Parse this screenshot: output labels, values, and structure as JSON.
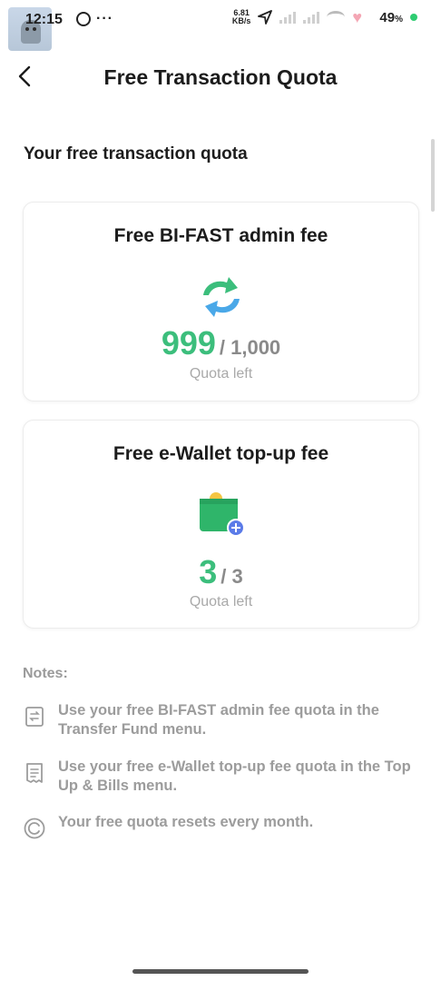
{
  "status_bar": {
    "time": "12:15",
    "net_speed_value": "6.81",
    "net_speed_unit": "KB/s",
    "battery": "49",
    "battery_unit": "%"
  },
  "header": {
    "title": "Free Transaction Quota"
  },
  "section": {
    "title": "Your free transaction quota"
  },
  "cards": [
    {
      "title": "Free BI-FAST admin fee",
      "icon": "transfer-arrows-icon",
      "used": "999",
      "total": "/ 1,000",
      "label": "Quota left"
    },
    {
      "title": "Free e-Wallet top-up fee",
      "icon": "wallet-icon",
      "used": "3",
      "total": "/ 3",
      "label": "Quota left"
    }
  ],
  "notes": {
    "title": "Notes:",
    "items": [
      {
        "icon": "transfer-doc-icon",
        "text": "Use your free BI-FAST admin fee quota in the Transfer Fund menu."
      },
      {
        "icon": "bill-doc-icon",
        "text": "Use your free e-Wallet top-up fee quota in the Top Up & Bills menu."
      },
      {
        "icon": "reset-cycle-icon",
        "text": "Your free quota resets every month."
      }
    ]
  },
  "colors": {
    "accent_green": "#3cbe7c",
    "accent_blue": "#4aa8e8",
    "muted_text": "#9c9c9c"
  }
}
